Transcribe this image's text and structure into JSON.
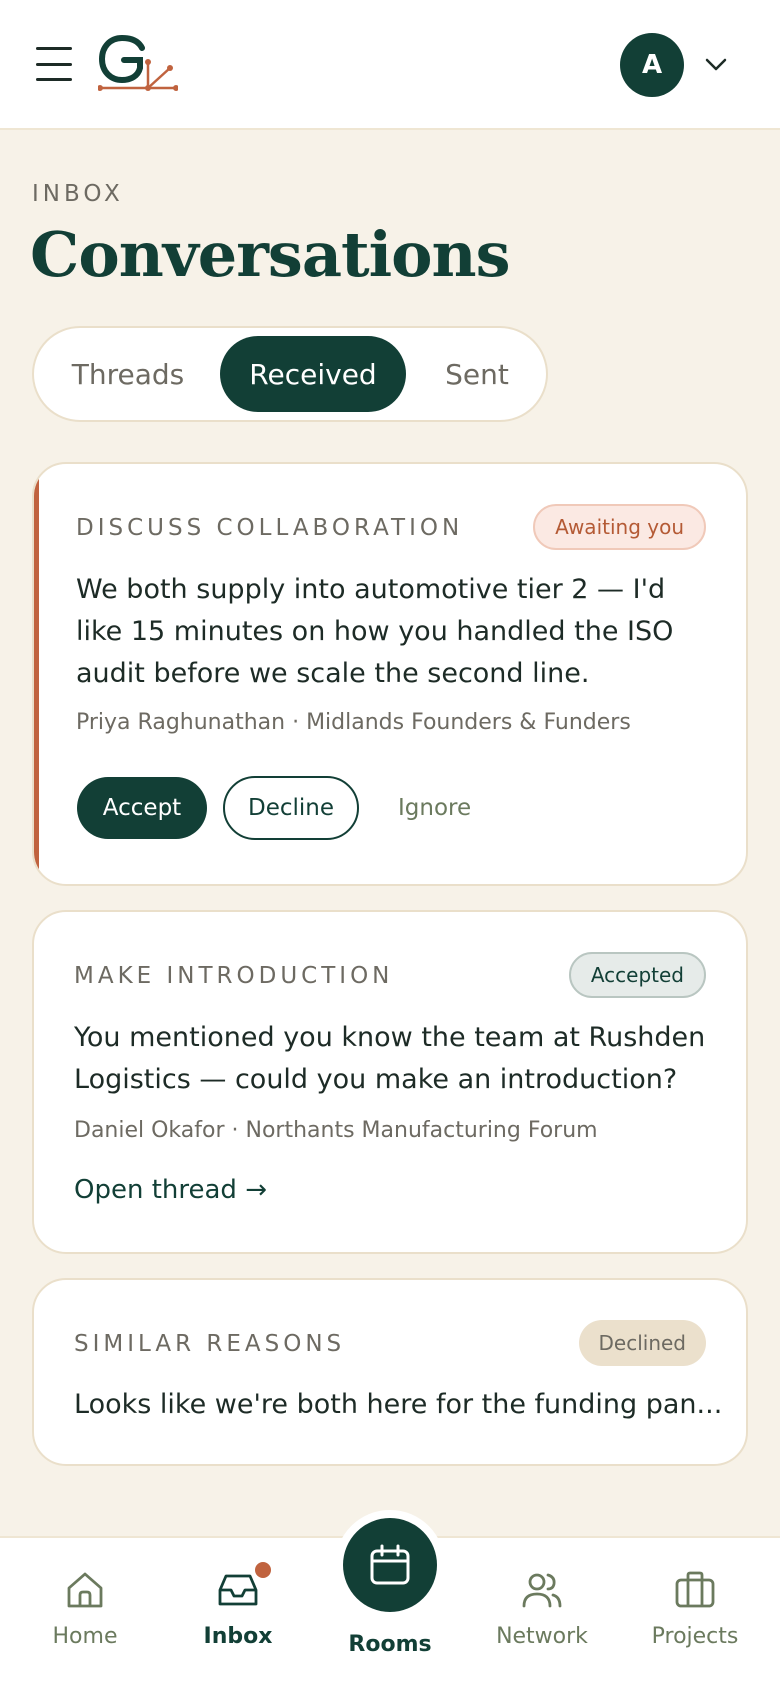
{
  "header": {
    "avatar_initial": "A"
  },
  "page": {
    "eyebrow": "INBOX",
    "title": "Conversations"
  },
  "tabs": [
    {
      "label": "Threads",
      "active": false
    },
    {
      "label": "Received",
      "active": true
    },
    {
      "label": "Sent",
      "active": false
    }
  ],
  "cards": [
    {
      "label": "DISCUSS COLLABORATION",
      "status": "Awaiting you",
      "message": "We both supply into automotive tier 2 — I'd like 15 minutes on how you handled the ISO audit before we scale the second line.",
      "meta": "Priya Raghunathan · Midlands Founders & Funders",
      "actions": {
        "accept": "Accept",
        "decline": "Decline",
        "ignore": "Ignore"
      }
    },
    {
      "label": "MAKE INTRODUCTION",
      "status": "Accepted",
      "message": "You mentioned you know the team at Rushden Logistics — could you make an introduction?",
      "meta": "Daniel Okafor · Northants Manufacturing Forum",
      "link": "Open thread →"
    },
    {
      "label": "SIMILAR REASONS",
      "status": "Declined",
      "message": "Looks like we're both here for the funding pan..."
    }
  ],
  "bottom_nav": {
    "home": "Home",
    "inbox": "Inbox",
    "rooms": "Rooms",
    "network": "Network",
    "projects": "Projects"
  },
  "colors": {
    "primary": "#123f36",
    "accent": "#c0633f",
    "background": "#f7f2e8",
    "awaiting_bg": "#fbe9e3",
    "accepted_bg": "#e6ebe9",
    "declined_bg": "#ebe0cc"
  },
  "icons": [
    "menu-icon",
    "logo",
    "chevron-down-icon",
    "home-icon",
    "inbox-icon",
    "calendar-icon",
    "users-icon",
    "briefcase-icon"
  ]
}
